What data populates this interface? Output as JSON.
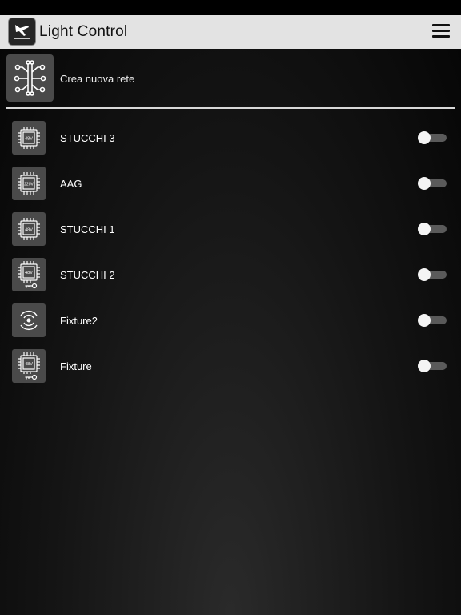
{
  "app": {
    "title": "Light Control"
  },
  "create_network": {
    "label": "Crea nuova rete",
    "icon": "network-tree-icon"
  },
  "devices": [
    {
      "name": "STUCCHI 3",
      "icon": "chip-icon",
      "chip_label": "48V",
      "on": false
    },
    {
      "name": "AAG",
      "icon": "chip-icon",
      "chip_label": "220V",
      "on": false
    },
    {
      "name": "STUCCHI 1",
      "icon": "chip-icon",
      "chip_label": "48V",
      "on": false
    },
    {
      "name": "STUCCHI 2",
      "icon": "chip-key-icon",
      "chip_label": "48V",
      "on": false
    },
    {
      "name": "Fixture2",
      "icon": "wireless-signal-icon",
      "on": false
    },
    {
      "name": "Fixture",
      "icon": "chip-key-icon",
      "chip_label": "48V",
      "on": false
    }
  ],
  "colors": {
    "titlebar": "#e3e3e3",
    "tile": "#4a4a4a",
    "toggle_track": "#5a5a5a"
  }
}
